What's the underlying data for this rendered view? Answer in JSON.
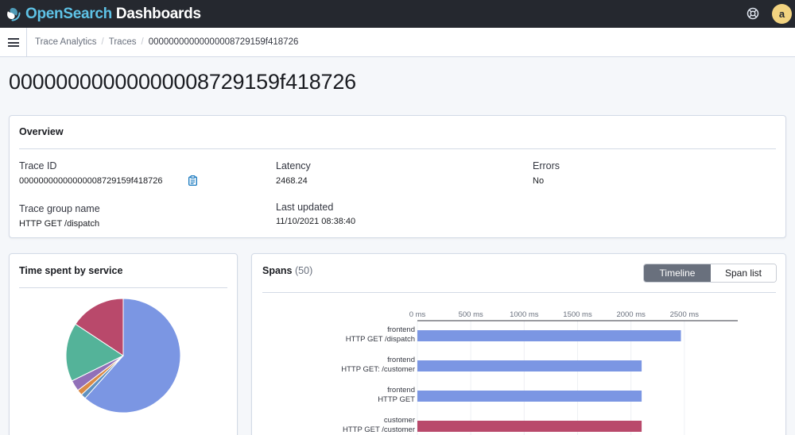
{
  "header": {
    "brand_open": "Open",
    "brand_search": "Search",
    "brand_dashboards": "Dashboards",
    "avatar_initial": "a"
  },
  "breadcrumbs": [
    "Trace Analytics",
    "Traces",
    "00000000000000008729159f418726"
  ],
  "page_title": "00000000000000008729159f418726",
  "overview": {
    "title": "Overview",
    "trace_id_label": "Trace ID",
    "trace_id_value": "00000000000000008729159f418726",
    "latency_label": "Latency",
    "latency_value": "2468.24",
    "errors_label": "Errors",
    "errors_value": "No",
    "group_label": "Trace group name",
    "group_value": "HTTP GET /dispatch",
    "updated_label": "Last updated",
    "updated_value": "11/10/2021 08:38:40"
  },
  "time_spent": {
    "title": "Time spent by service"
  },
  "spans": {
    "title": "Spans",
    "count": "(50)",
    "toggle_timeline": "Timeline",
    "toggle_span_list": "Span list"
  },
  "colors": {
    "frontend": "#7b96e3",
    "customer": "#b9496b",
    "teal": "#54b399",
    "purple": "#9170b8",
    "orange": "#da8b45",
    "blue_dark": "#6092c0"
  },
  "chart_data": [
    {
      "type": "pie",
      "title": "Time spent by service",
      "slices": [
        {
          "value": 61.6
        },
        {
          "value": 1.4
        },
        {
          "value": 1.6
        },
        {
          "value": 3.1
        },
        {
          "value": 16.6
        },
        {
          "value": 15.7
        }
      ],
      "slice_colors": [
        "#7b96e3",
        "#6092c0",
        "#da8b45",
        "#9170b8",
        "#54b399",
        "#b9496b"
      ]
    },
    {
      "type": "bar",
      "orientation": "horizontal",
      "title": "Spans",
      "x_ticks": [
        "0 ms",
        "500 ms",
        "1000 ms",
        "1500 ms",
        "2000 ms",
        "2500 ms"
      ],
      "xlim": [
        0,
        3000
      ],
      "categories": [
        [
          "frontend",
          "HTTP GET /dispatch"
        ],
        [
          "frontend",
          "HTTP GET: /customer"
        ],
        [
          "frontend",
          "HTTP GET"
        ],
        [
          "customer",
          "HTTP GET /customer"
        ]
      ],
      "values": [
        2468,
        2100,
        2100,
        2100
      ],
      "bar_colors": [
        "#7b96e3",
        "#7b96e3",
        "#7b96e3",
        "#b9496b"
      ]
    }
  ]
}
